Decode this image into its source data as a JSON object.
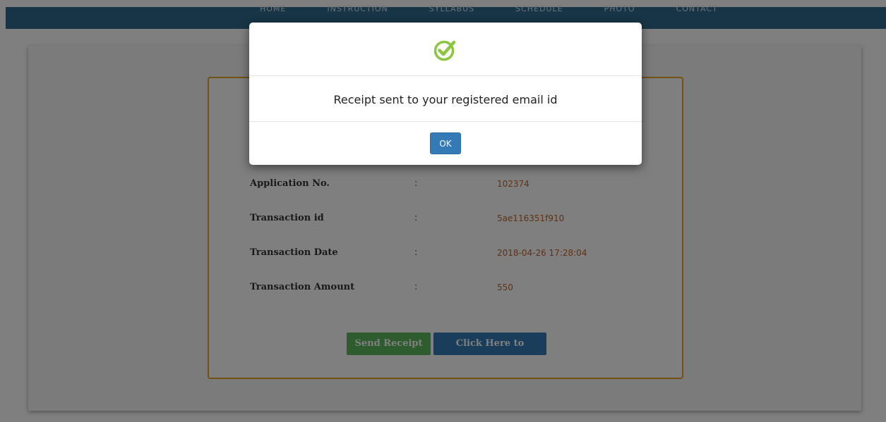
{
  "nav": {
    "items": [
      "HOME",
      "INSTRUCTION",
      "SYLLABUS",
      "SCHEDULE",
      "PHOTO",
      "CONTACT"
    ]
  },
  "receipt": {
    "rows": [
      {
        "label": "Application No.",
        "separator": ":",
        "value": "102374"
      },
      {
        "label": "Transaction id",
        "separator": ":",
        "value": "5ae116351f910"
      },
      {
        "label": "Transaction Date",
        "separator": ":",
        "value": "2018-04-26 17:28:04"
      },
      {
        "label": "Transaction Amount",
        "separator": ":",
        "value": "550"
      }
    ],
    "send_receipt_label": "Send Receipt",
    "login_label": "Click Here to Login"
  },
  "modal": {
    "icon": "check-circle-icon",
    "message": "Receipt sent to your registered email id",
    "ok_label": "OK"
  },
  "colors": {
    "navbar": "#2f6a8c",
    "box_border": "#e3a520",
    "value_text": "#c0622a",
    "success_green": "#8cc63f",
    "primary_blue": "#337ab7",
    "send_green": "#5cb85c"
  }
}
